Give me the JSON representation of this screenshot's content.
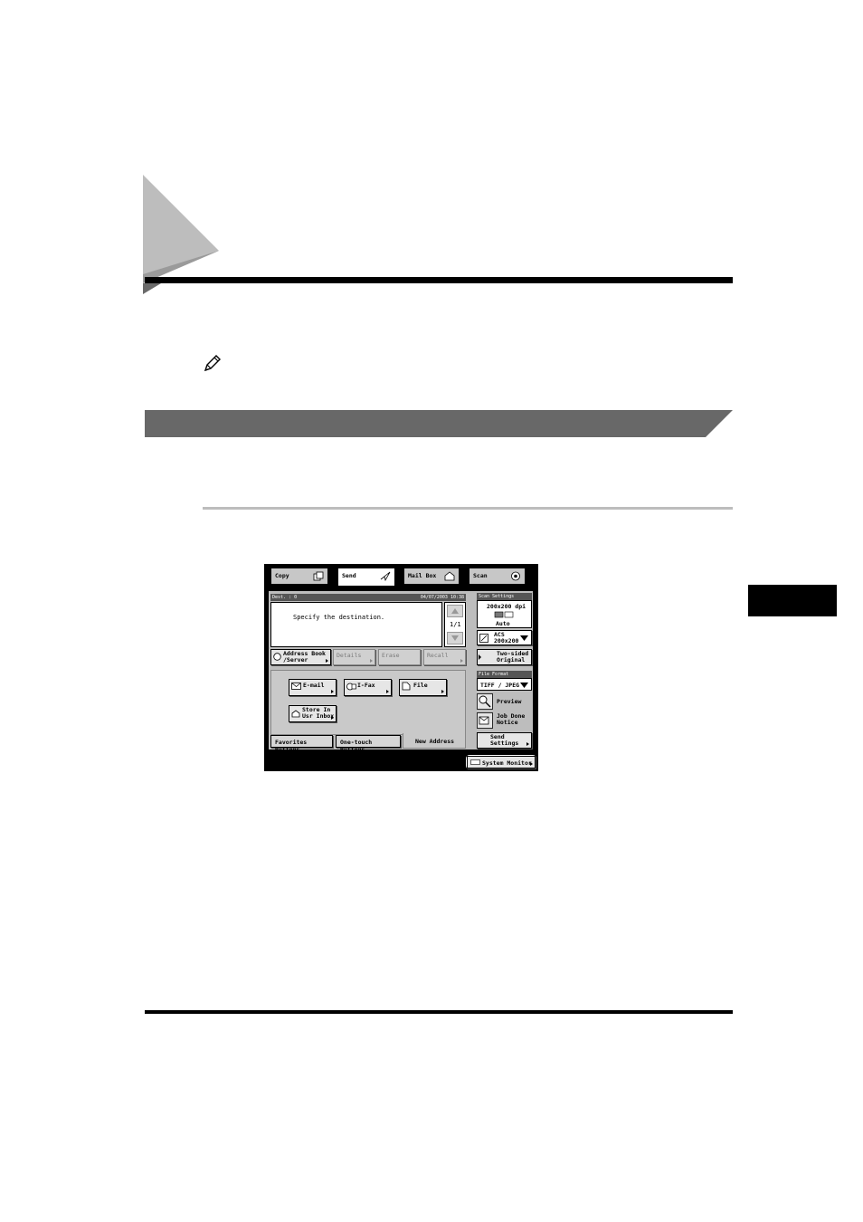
{
  "screen": {
    "tabs": [
      {
        "label": "Copy",
        "icon": "copy-icon"
      },
      {
        "label": "Send",
        "icon": "send-icon"
      },
      {
        "label": "Mail Box",
        "icon": "mailbox-icon"
      },
      {
        "label": "Scan",
        "icon": "scan-icon"
      }
    ],
    "status_left": "Dest. :  0",
    "status_right": "04/07/2003 10:38",
    "message": "Specify the destination.",
    "page_indicator": "1/1",
    "action_buttons": [
      {
        "label": "Address Book\n/Server",
        "enabled": true
      },
      {
        "label": "Details",
        "enabled": false
      },
      {
        "label": "Erase",
        "enabled": false
      },
      {
        "label": "Recall",
        "enabled": false
      }
    ],
    "address_buttons": [
      {
        "label": "E-mail",
        "icon": "email-icon"
      },
      {
        "label": "I-Fax",
        "icon": "ifax-icon"
      },
      {
        "label": "File",
        "icon": "file-icon"
      },
      {
        "label": "Store In\nUsr Inbox",
        "icon": "inbox-icon"
      }
    ],
    "bottom_tabs": [
      "Favorites Buttons",
      "One-touch Buttons",
      "New Address"
    ],
    "scan_settings": {
      "header": "Scan Settings",
      "resolution": "200x200 dpi",
      "density": "Auto",
      "mode": "ACS\n200x200"
    },
    "two_sided": "Two-sided\nOriginal",
    "file_format": {
      "header": "File Format",
      "value": "TIFF / JPEG"
    },
    "preview": "Preview",
    "job_done_notice": "Job Done\nNotice",
    "send_settings": "Send\nSettings",
    "system_monitor": "System Monitor"
  }
}
